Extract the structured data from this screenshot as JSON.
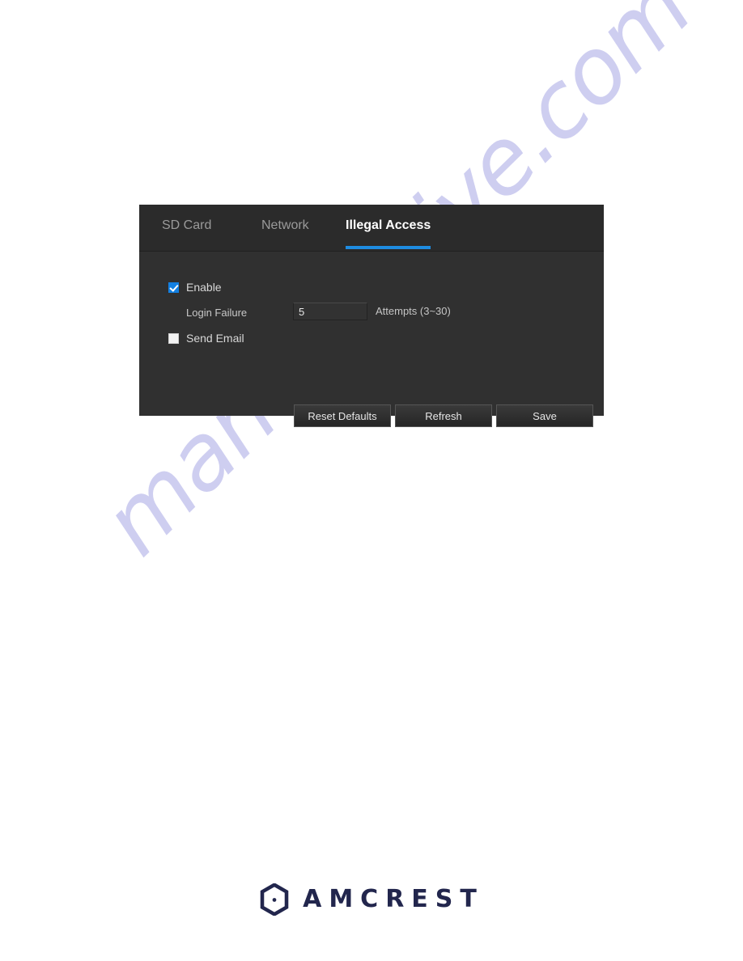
{
  "panel": {
    "tabs": [
      {
        "label": "SD Card",
        "active": false
      },
      {
        "label": "Network",
        "active": false
      },
      {
        "label": "Illegal Access",
        "active": true
      }
    ],
    "accent_color": "#1e8ce0",
    "header_bg": "#2b2b2b",
    "body_bg": "#303030",
    "form": {
      "enable": {
        "label": "Enable",
        "checked": true
      },
      "login_failure": {
        "label": "Login Failure",
        "value": "5",
        "unit_label": "Attempts (3~30)"
      },
      "send_email": {
        "label": "Send Email",
        "checked": false
      }
    },
    "buttons": {
      "reset": "Reset Defaults",
      "refresh": "Refresh",
      "save": "Save"
    }
  },
  "watermark": {
    "text": "manualshive.com",
    "color": "#9b9be0"
  },
  "footer": {
    "brand": "AMCREST",
    "brand_color": "#22264d",
    "logo_icon": "amcrest-hexagon-eye-icon"
  }
}
